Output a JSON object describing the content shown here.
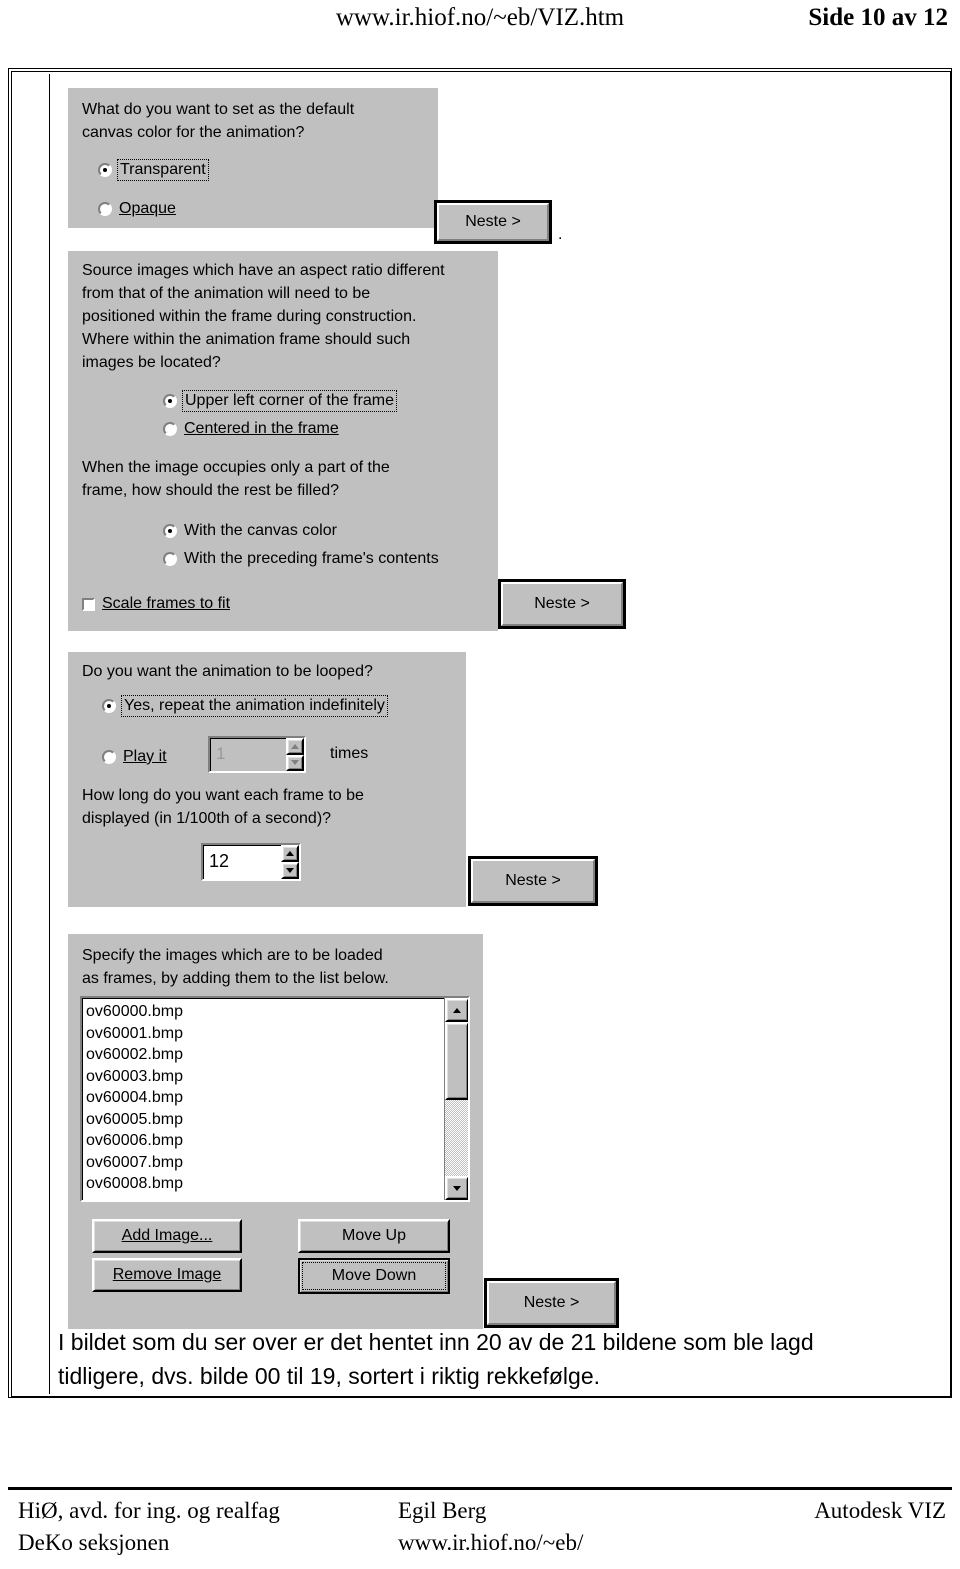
{
  "header": {
    "url": "www.ir.hiof.no/~eb/VIZ.htm",
    "page_label": "Side 10 av 12"
  },
  "panels": {
    "canvas_color": {
      "question": "What do you want to set as the default\ncanvas color for the animation?",
      "options": [
        {
          "label": "Transparent",
          "selected": true,
          "focused": true
        },
        {
          "label": "Opaque",
          "selected": false,
          "focused": false
        }
      ],
      "next_button": "Neste >",
      "trailing_mark": "."
    },
    "positioning": {
      "question": "Source images which have an aspect ratio different\nfrom that of the animation will need to be\npositioned within the frame during construction.\nWhere within the animation frame should such\nimages be located?",
      "options": [
        {
          "label": "Upper left corner of the frame",
          "selected": true,
          "focused": true
        },
        {
          "label": "Centered in the frame",
          "selected": false,
          "focused": false
        }
      ],
      "question2": "When the image occupies only a part of the\nframe, how should the rest be filled?",
      "options2": [
        {
          "label": "With the canvas color",
          "selected": true,
          "focused": false
        },
        {
          "label": "With the preceding frame's contents",
          "selected": false,
          "focused": false
        }
      ],
      "checkbox": {
        "label": "Scale frames to fit",
        "checked": false
      },
      "next_button": "Neste >"
    },
    "looping": {
      "question": "Do you want the animation to be looped?",
      "options": [
        {
          "label": "Yes, repeat the animation indefinitely",
          "selected": true,
          "focused": true
        },
        {
          "label": "Play it",
          "selected": false,
          "focused": false
        }
      ],
      "play_count_value": "1",
      "play_count_suffix": "times",
      "question2": "How long do you want each frame to be\ndisplayed (in 1/100th of a second)?",
      "frame_delay_value": "12",
      "next_button": "Neste >"
    },
    "images": {
      "question": "Specify the images which are to be loaded\nas frames, by adding them to the list below.",
      "files": [
        "ov60000.bmp",
        "ov60001.bmp",
        "ov60002.bmp",
        "ov60003.bmp",
        "ov60004.bmp",
        "ov60005.bmp",
        "ov60006.bmp",
        "ov60007.bmp",
        "ov60008.bmp"
      ],
      "buttons": {
        "add_image": "Add Image...",
        "remove_image": "Remove Image",
        "move_up": "Move Up",
        "move_down": "Move Down",
        "next": "Neste >"
      }
    }
  },
  "body_text": "I bildet som du ser over er det hentet inn 20 av de 21 bildene som ble lagd tidligere, dvs. bilde 00 til 19, sortert i riktig rekkefølge.",
  "footer": {
    "left_line1": "HiØ, avd. for ing. og realfag",
    "left_line2": "DeKo seksjonen",
    "mid_line1": "Egil Berg",
    "mid_line2": "www.ir.hiof.no/~eb/",
    "right_line1": "Autodesk VIZ"
  }
}
